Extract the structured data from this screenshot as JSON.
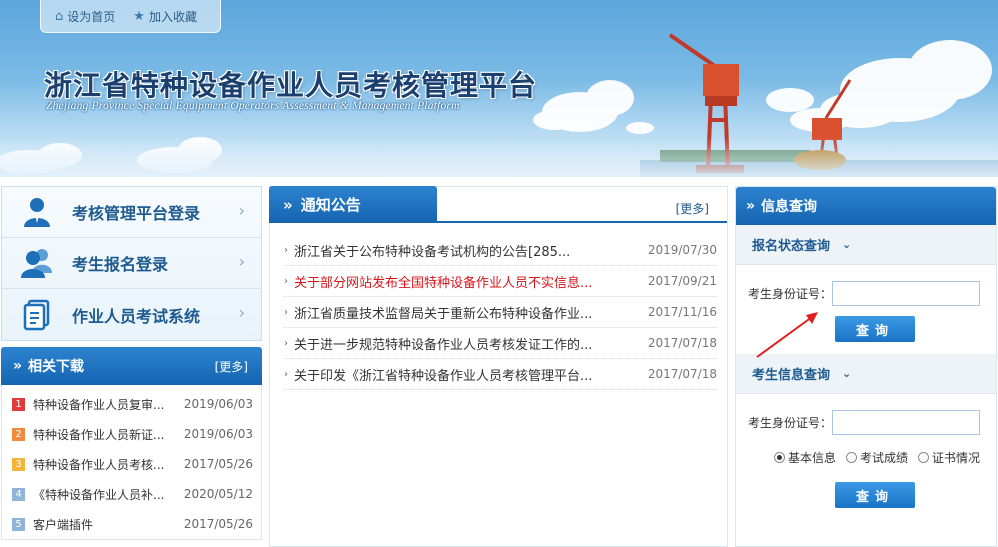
{
  "header": {
    "toplinks": [
      {
        "label": "设为首页",
        "icon": "home-icon"
      },
      {
        "label": "加入收藏",
        "icon": "star-icon"
      }
    ],
    "title": "浙江省特种设备作业人员考核管理平台",
    "subtitle": "Zhejiang Province Special Equipment Operators Assessment & Management Platform"
  },
  "login": {
    "items": [
      {
        "label": "考核管理平台登录",
        "icon": "user-icon"
      },
      {
        "label": "考生报名登录",
        "icon": "users-icon"
      },
      {
        "label": "作业人员考试系统",
        "icon": "document-icon"
      }
    ]
  },
  "downloads": {
    "title": "相关下载",
    "more": "[更多]",
    "items": [
      {
        "num": "1",
        "color": "#e23b3b",
        "name": "特种设备作业人员复审...",
        "date": "2019/06/03"
      },
      {
        "num": "2",
        "color": "#f08a3c",
        "name": "特种设备作业人员新证...",
        "date": "2019/06/03"
      },
      {
        "num": "3",
        "color": "#f3b43a",
        "name": "特种设备作业人员考核...",
        "date": "2017/05/26"
      },
      {
        "num": "4",
        "color": "#8fb3d9",
        "name": "《特种设备作业人员补...",
        "date": "2020/05/12"
      },
      {
        "num": "5",
        "color": "#8fb3d9",
        "name": "客户端插件",
        "date": "2017/05/26"
      }
    ]
  },
  "notices": {
    "title": "通知公告",
    "more": "[更多]",
    "items": [
      {
        "title": "浙江省关于公布特种设备考试机构的公告[285...",
        "date": "2019/07/30",
        "highlight": false
      },
      {
        "title": "关于部分网站发布全国特种设备作业人员不实信息...",
        "date": "2017/09/21",
        "highlight": true
      },
      {
        "title": "浙江省质量技术监督局关于重新公布特种设备作业...",
        "date": "2017/11/16",
        "highlight": false
      },
      {
        "title": "关于进一步规范特种设备作业人员考核发证工作的...",
        "date": "2017/07/18",
        "highlight": false
      },
      {
        "title": "关于印发《浙江省特种设备作业人员考核管理平台...",
        "date": "2017/07/18",
        "highlight": false
      }
    ]
  },
  "query": {
    "title": "信息查询",
    "status": {
      "title": "报名状态查询",
      "id_label": "考生身份证号：",
      "id_value": "",
      "button": "查询"
    },
    "info": {
      "title": "考生信息查询",
      "id_label": "考生身份证号：",
      "id_value": "",
      "options": [
        {
          "label": "基本信息",
          "checked": true
        },
        {
          "label": "考试成绩",
          "checked": false
        },
        {
          "label": "证书情况",
          "checked": false
        }
      ],
      "button": "查询"
    }
  },
  "colors": {
    "primary": "#1565b1",
    "highlight_text": "#d7161c",
    "annotation_arrow": "#e02020"
  }
}
